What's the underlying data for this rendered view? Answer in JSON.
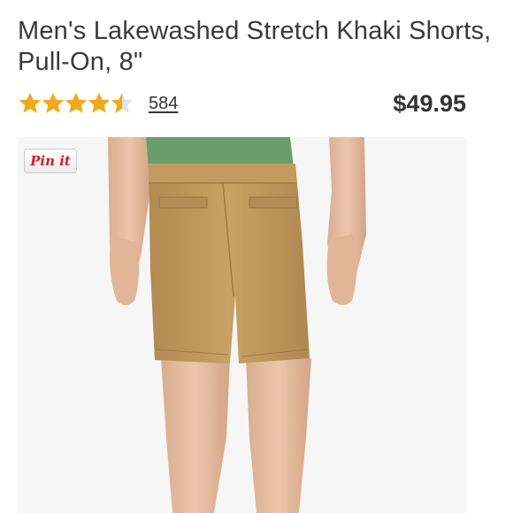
{
  "product": {
    "title": "Men's Lakewashed Stretch Khaki Shorts, Pull-On, 8\"",
    "rating_value": 4.5,
    "rating_max": 5,
    "review_count": "584",
    "price": "$49.95"
  },
  "image": {
    "pin_label": "Pin it"
  },
  "colors": {
    "star": "#f0a91c",
    "star_empty": "#e3e3e3",
    "pin_red": "#cb2027",
    "khaki": "#c29a5e",
    "shirt": "#6b9c6b",
    "background": "#f6f6f6"
  },
  "icons": [
    "star-icon",
    "pinterest-pin-it-icon"
  ]
}
